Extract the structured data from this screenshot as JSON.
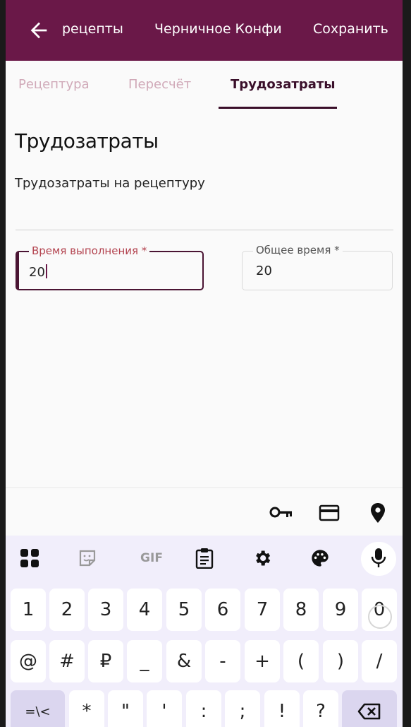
{
  "appbar": {
    "back_label": "рецепты",
    "title": "Черничное Конфи",
    "save_label": "Сохранить"
  },
  "tabs": [
    {
      "label": "Рецептура",
      "active": false
    },
    {
      "label": "Пересчёт",
      "active": false
    },
    {
      "label": "Трудозатраты",
      "active": true
    }
  ],
  "section": {
    "title": "Трудозатраты",
    "subtitle": "Трудозатраты на рецептуру"
  },
  "fields": {
    "execution_time": {
      "label": "Время выполнения *",
      "value": "20"
    },
    "total_time": {
      "label": "Общее время *",
      "value": "20"
    }
  },
  "keyboard": {
    "suggestion_icons": [
      "key-icon",
      "card-icon",
      "location-pin-icon"
    ],
    "tool_icons": [
      "apps-grid-icon",
      "sticker-icon",
      "gif-icon",
      "clipboard-icon",
      "settings-gear-icon",
      "palette-icon",
      "microphone-icon"
    ],
    "gif_label": "GIF",
    "row1": [
      "1",
      "2",
      "3",
      "4",
      "5",
      "6",
      "7",
      "8",
      "9",
      "0"
    ],
    "row2": [
      "@",
      "#",
      "₽",
      "_",
      "&",
      "-",
      "+",
      "(",
      ")",
      "/"
    ],
    "row3": [
      "=\\<",
      "*",
      "\"",
      "'",
      ":",
      ";",
      "!",
      "?"
    ],
    "backspace_icon": "backspace-icon"
  },
  "colors": {
    "primary": "#6a1848",
    "active_tab": "#3a0f2a",
    "inactive_tab": "#d0a9b8",
    "focus_label": "#b3434f",
    "keyboard_bg": "#f1eefb"
  }
}
